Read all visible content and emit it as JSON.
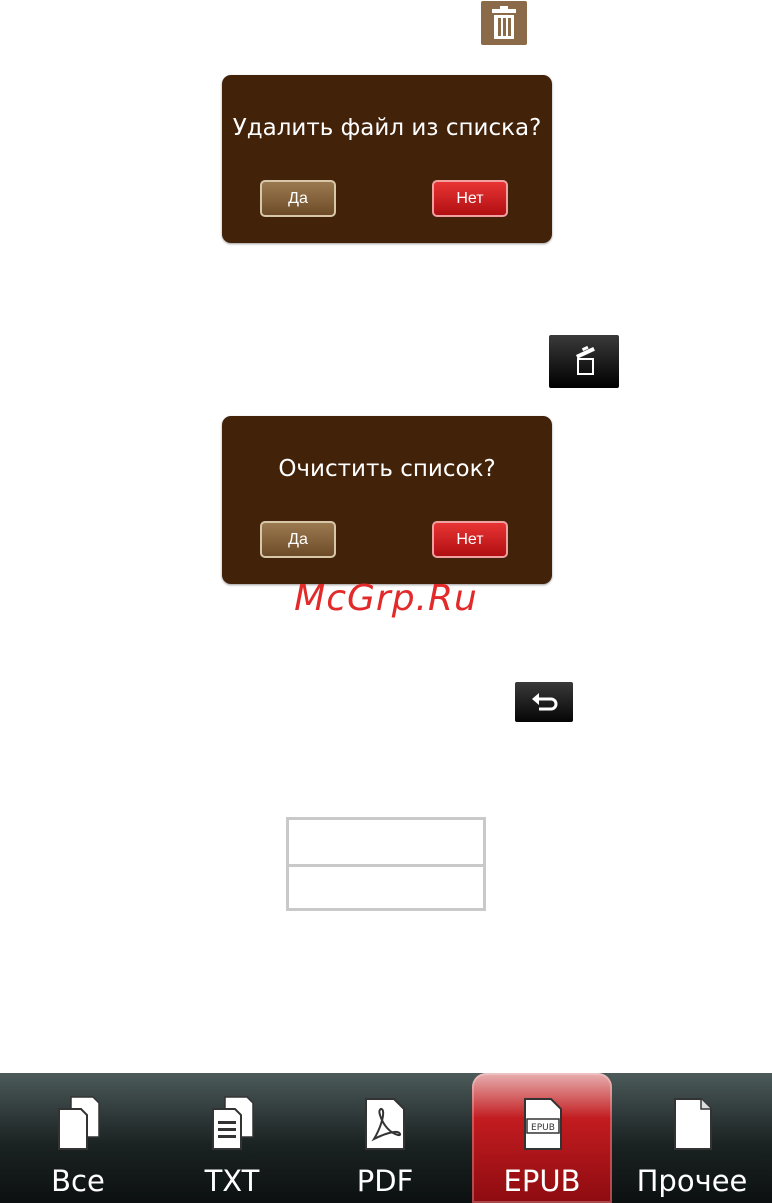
{
  "icons": {
    "delete": "trash-icon",
    "clear_list": "clear-list-icon",
    "back": "back-icon"
  },
  "dialogs": [
    {
      "title": "Удалить файл из списка?",
      "yes": "Да",
      "no": "Нет"
    },
    {
      "title": "Очистить список?",
      "yes": "Да",
      "no": "Нет"
    }
  ],
  "watermark": "McGrp.Ru",
  "tabs": [
    {
      "label": "Все",
      "icon": "all-files-icon",
      "active": false
    },
    {
      "label": "TXT",
      "icon": "txt-file-icon",
      "active": false
    },
    {
      "label": "PDF",
      "icon": "pdf-file-icon",
      "active": false
    },
    {
      "label": "EPUB",
      "icon": "epub-file-icon",
      "active": true,
      "badge": "EPUB"
    },
    {
      "label": "Прочее",
      "icon": "other-file-icon",
      "active": false
    }
  ],
  "colors": {
    "dialog_bg": "#43220a",
    "yes_button": "#8a6a48",
    "no_button": "#d01e22",
    "active_tab": "#c21c20",
    "tabbar_bg": "#1b2222"
  }
}
